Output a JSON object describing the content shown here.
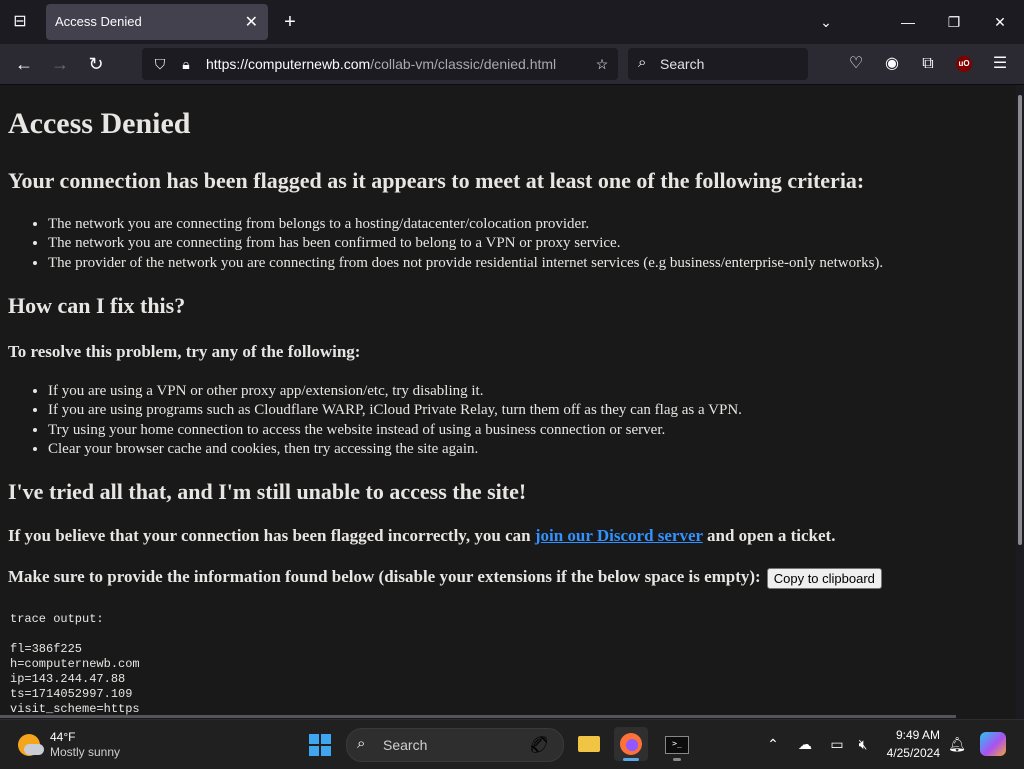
{
  "browser": {
    "tab_title": "Access Denied",
    "url_host": "https://computernewb.com",
    "url_path": "/collab-vm/classic/denied.html",
    "search_placeholder": "Search"
  },
  "page": {
    "title": "Access Denied",
    "flagged_heading": "Your connection has been flagged as it appears to meet at least one of the following criteria:",
    "criteria": [
      "The network you are connecting from belongs to a hosting/datacenter/colocation provider.",
      "The network you are connecting from has been confirmed to belong to a VPN or proxy service.",
      "The provider of the network you are connecting from does not provide residential internet services (e.g business/enterprise-only networks)."
    ],
    "fix_heading": "How can I fix this?",
    "resolve_heading": "To resolve this problem, try any of the following:",
    "fixes": [
      "If you are using a VPN or other proxy app/extension/etc, try disabling it.",
      "If you are using programs such as Cloudflare WARP, iCloud Private Relay, turn them off as they can flag as a VPN.",
      "Try using your home connection to access the website instead of using a business connection or server.",
      "Clear your browser cache and cookies, then try accessing the site again."
    ],
    "still_heading": "I've tried all that, and I'm still unable to access the site!",
    "incorrect_prefix": "If you believe that your connection has been flagged incorrectly, you can ",
    "discord_link": "join our Discord server",
    "incorrect_suffix": " and open a ticket.",
    "provide_info": "Make sure to provide the information found below (disable your extensions if the below space is empty):",
    "copy_button": "Copy to clipboard",
    "trace_label": "trace output:",
    "trace_lines": [
      "fl=386f225",
      "h=computernewb.com",
      "ip=143.244.47.88",
      "ts=1714052997.109",
      "visit_scheme=https"
    ]
  },
  "taskbar": {
    "weather_temp": "44°F",
    "weather_desc": "Mostly sunny",
    "search_placeholder": "Search",
    "time": "9:49 AM",
    "date": "4/25/2024"
  },
  "colors": {
    "page_bg": "#191919",
    "text": "#e8e6e3",
    "link": "#3391ff",
    "chrome_bg": "#1c1b22",
    "toolbar_bg": "#2b2a33"
  }
}
